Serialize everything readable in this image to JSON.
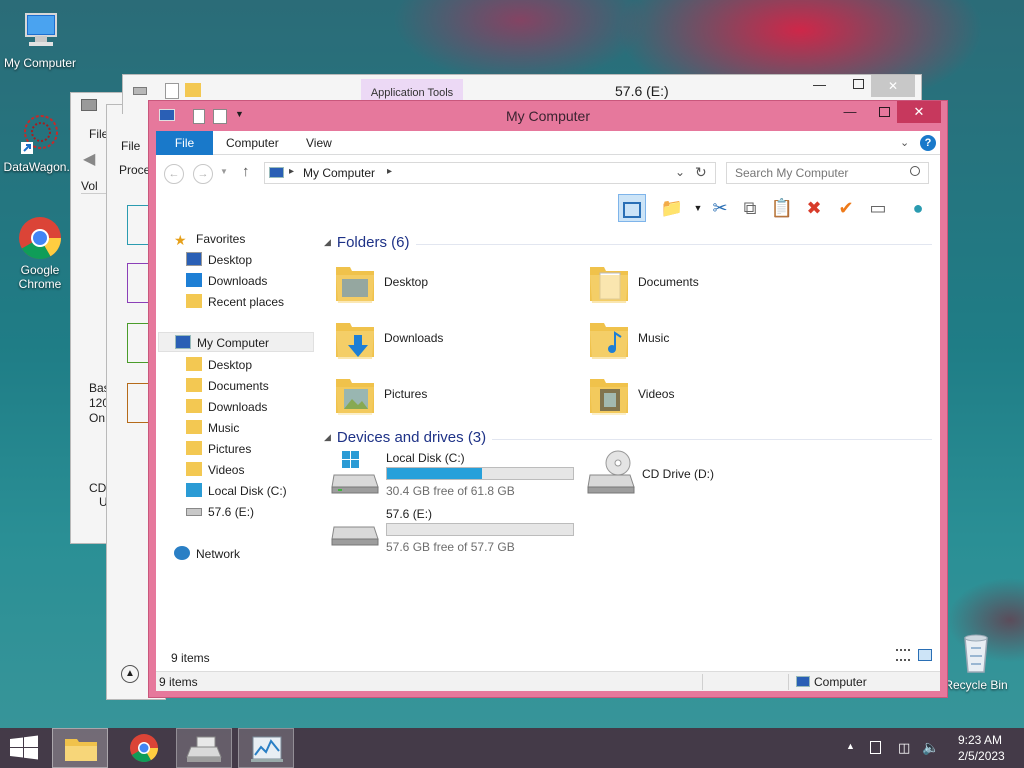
{
  "desktop": {
    "icons": [
      {
        "label": "My Computer"
      },
      {
        "label": "DataWagon..."
      },
      {
        "label": "Google Chrome"
      },
      {
        "label": "Recycle Bin"
      }
    ]
  },
  "bg_window_1": {
    "ribbon_context": "Application Tools",
    "title": "57.6 (E:)"
  },
  "bg_window_2": {
    "tab": "File",
    "toolbar_text": "Proce",
    "col": "Vol",
    "lines": [
      "Bas",
      "120",
      "On",
      "CD",
      "U"
    ]
  },
  "bg_window_3": {
    "tab": "File"
  },
  "window": {
    "title": "My Computer",
    "tabs": [
      "File",
      "Computer",
      "View"
    ],
    "address": {
      "root": "My Computer"
    },
    "search_placeholder": "Search My Computer",
    "navigation": {
      "favorites": {
        "label": "Favorites",
        "items": [
          "Desktop",
          "Downloads",
          "Recent places"
        ]
      },
      "computer": {
        "label": "My Computer",
        "items": [
          "Desktop",
          "Documents",
          "Downloads",
          "Music",
          "Pictures",
          "Videos",
          "Local Disk (C:)",
          "57.6 (E:)"
        ]
      },
      "network": {
        "label": "Network"
      }
    },
    "groups": {
      "folders": {
        "title": "Folders (6)",
        "items": [
          "Desktop",
          "Documents",
          "Downloads",
          "Music",
          "Pictures",
          "Videos"
        ]
      },
      "devices": {
        "title": "Devices and drives (3)",
        "drives": [
          {
            "name": "Local Disk (C:)",
            "free_text": "30.4 GB free of 61.8 GB",
            "used_fraction": 0.51
          },
          {
            "name": "57.6 (E:)",
            "free_text": "57.6 GB free of 57.7 GB",
            "used_fraction": 0.0
          },
          {
            "name": "CD Drive (D:)"
          }
        ]
      }
    },
    "status": {
      "items_inner": "9 items",
      "items_outer": "9 items",
      "location": "Computer"
    }
  },
  "taskbar": {
    "time": "9:23 AM",
    "date": "2/5/2023"
  }
}
